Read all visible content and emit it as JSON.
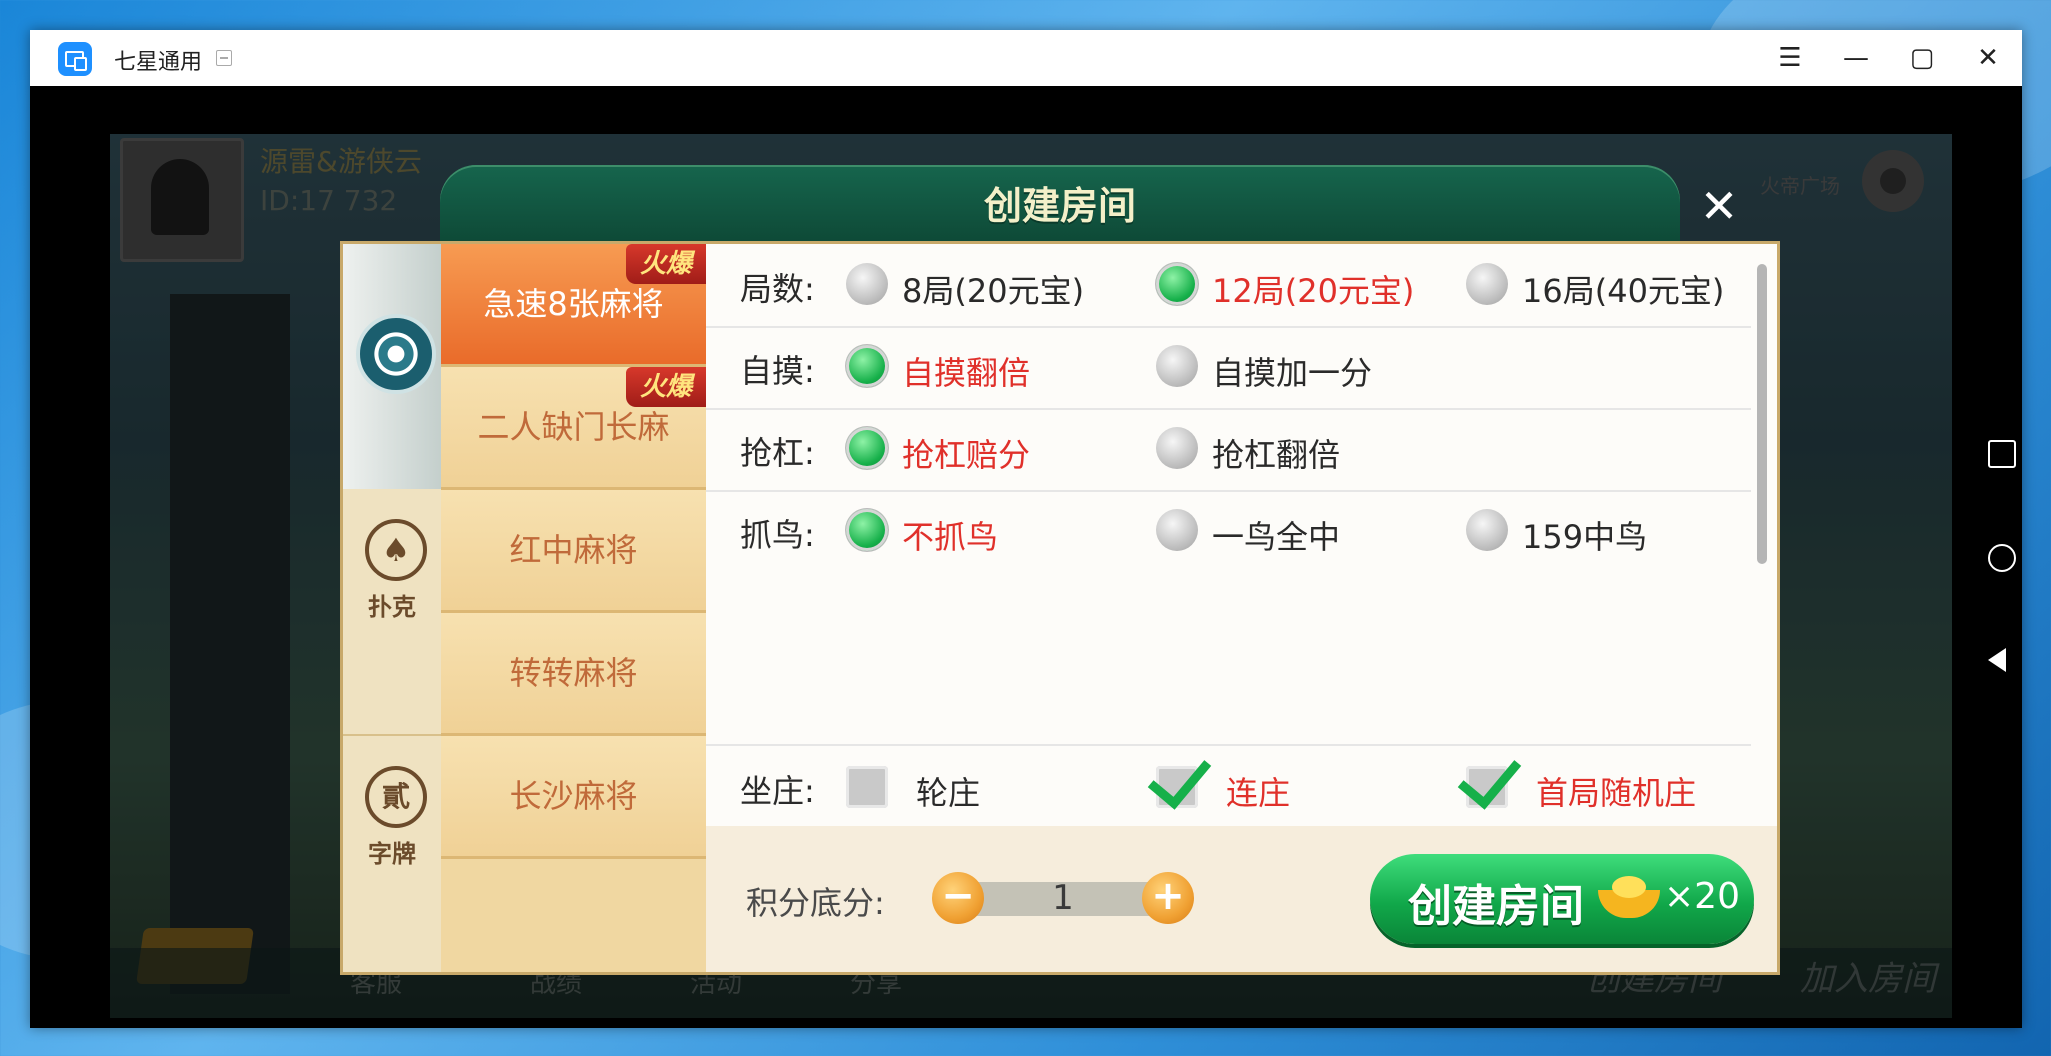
{
  "window": {
    "title": "七星通用"
  },
  "background_game": {
    "player_name": "源雷&游侠云",
    "player_id": "ID:17 732",
    "square_label": "火帝广场",
    "bottom_items": [
      "客服",
      "战绩",
      "活动",
      "分享"
    ],
    "create_room_label": "创建房间",
    "join_room_label": "加入房间"
  },
  "dialog": {
    "title": "创建房间",
    "categories": [
      {
        "name": "mahjong",
        "label": ""
      },
      {
        "name": "poker",
        "label": "扑克"
      },
      {
        "name": "tiles",
        "label": "字牌",
        "glyph": "貳"
      }
    ],
    "games": [
      {
        "label": "急速8张麻将",
        "active": true,
        "badge": "火爆"
      },
      {
        "label": "二人缺门长麻",
        "active": false,
        "badge": "火爆"
      },
      {
        "label": "红中麻将",
        "active": false,
        "badge": ""
      },
      {
        "label": "转转麻将",
        "active": false,
        "badge": ""
      },
      {
        "label": "长沙麻将",
        "active": false,
        "badge": ""
      }
    ],
    "rows": {
      "rounds": {
        "label": "局数:",
        "options": [
          {
            "label": "8局(20元宝)",
            "selected": false
          },
          {
            "label": "12局(20元宝)",
            "selected": true
          },
          {
            "label": "16局(40元宝)",
            "selected": false
          }
        ]
      },
      "zimo": {
        "label": "自摸:",
        "options": [
          {
            "label": "自摸翻倍",
            "selected": true
          },
          {
            "label": "自摸加一分",
            "selected": false
          }
        ]
      },
      "qianggang": {
        "label": "抢杠:",
        "options": [
          {
            "label": "抢杠赔分",
            "selected": true
          },
          {
            "label": "抢杠翻倍",
            "selected": false
          }
        ]
      },
      "zhuaniao": {
        "label": "抓鸟:",
        "options": [
          {
            "label": "不抓鸟",
            "selected": true
          },
          {
            "label": "一鸟全中",
            "selected": false
          },
          {
            "label": "159中鸟",
            "selected": false
          }
        ]
      },
      "zuozhuang": {
        "label": "坐庄:",
        "options": [
          {
            "label": "轮庄",
            "checked": false
          },
          {
            "label": "连庄",
            "checked": true
          },
          {
            "label": "首局随机庄",
            "checked": true
          }
        ]
      }
    },
    "footer": {
      "score_label": "积分底分:",
      "score_value": "1",
      "minus": "−",
      "plus": "+",
      "create_label": "创建房间",
      "cost": "×20"
    }
  },
  "colors": {
    "accent_green": "#16b04a",
    "selected_text": "#e0302a",
    "header": "#16654d"
  }
}
